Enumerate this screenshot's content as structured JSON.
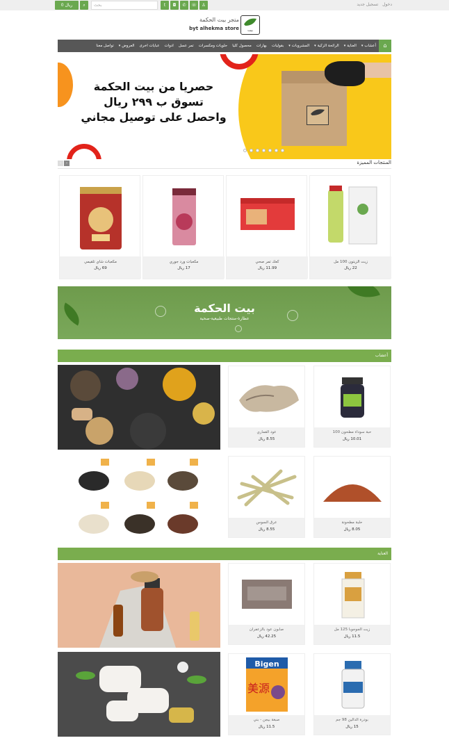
{
  "topbar": {
    "cart_label": "0 ريال",
    "search_placeholder": "بحث",
    "links": [
      "دخول",
      "تسجيل جديد"
    ],
    "social": [
      "twitter-icon",
      "instagram-icon",
      "whatsapp-icon",
      "snapchat-icon"
    ]
  },
  "logo": {
    "arabic": "متجر بيت الحكمة",
    "english": "byt alhekma store",
    "box_text": "بيت الحكمة"
  },
  "nav": {
    "items": [
      "أعشاب",
      "العناية",
      "الرائحة الزكية",
      "المشروبات",
      "بقوليات",
      "بهارات",
      "محصول كليا",
      "حلويات ومكسرات",
      "تمر عسل",
      "ادوات",
      "عبايات اخرى",
      "العروض",
      "تواصل معنا"
    ],
    "dropdown_flags": [
      true,
      true,
      true,
      true,
      false,
      false,
      false,
      false,
      false,
      false,
      false,
      true,
      false
    ]
  },
  "hero": {
    "line1": "حصريا من بيت الحكمة",
    "line2": "تسوق ب ٢٩٩ ريال",
    "line3": "واحصل على توصيل مجاني",
    "box_label": "بيت الحكمة",
    "slides": 7
  },
  "featured": {
    "title": "المنتجات المميزة",
    "items": [
      {
        "name": "مكعبات شاي تلقيمي",
        "price": "69 ريال",
        "kind": "tin"
      },
      {
        "name": "مكعبات ورد جوري",
        "price": "17 ريال",
        "kind": "tube"
      },
      {
        "name": "كعك تمر صحي",
        "price": "11.99 ريال",
        "kind": "redbox"
      },
      {
        "name": "زيت الزيتون 100 مل",
        "price": "22 ريال",
        "kind": "bottle"
      }
    ]
  },
  "banner": {
    "title": "بيت الحكمة",
    "subtitle": "عطارة-منتجات طبيعية-صحية"
  },
  "herbs": {
    "title": "أعشاب",
    "items": [
      {
        "name": "حبة سوداء مطحون 100",
        "price": "10.01 ريال",
        "kind": "jar"
      },
      {
        "name": "عود القماري",
        "price": "8.55 ريال",
        "kind": "wood"
      },
      {
        "name": "حلبة مطحونة",
        "price": "8.05 ريال",
        "kind": "powder"
      },
      {
        "name": "عرق السوس",
        "price": "8.55 ريال",
        "kind": "sticks"
      }
    ]
  },
  "care": {
    "title": "العناية",
    "items": [
      {
        "name": "زيت الجوجوبا 125 مل",
        "price": "11.5 ريال",
        "kind": "oil"
      },
      {
        "name": "صابون عود بالزعفران",
        "price": "42.25 ريال",
        "kind": "soap"
      },
      {
        "name": "بودرة الدالين 98 جم",
        "price": "15 ريال",
        "kind": "powderbottle"
      },
      {
        "name": "صبغة بيجن - بني",
        "price": "11.5 ريال",
        "kind": "bigen"
      }
    ],
    "bigen_brand": "Bigen",
    "bigen_kanji": "美源"
  },
  "colors": {
    "green": "#7aad4e",
    "nav": "#575757",
    "yellow": "#f9c81a",
    "orange": "#f7931e",
    "red": "#e2231a"
  }
}
